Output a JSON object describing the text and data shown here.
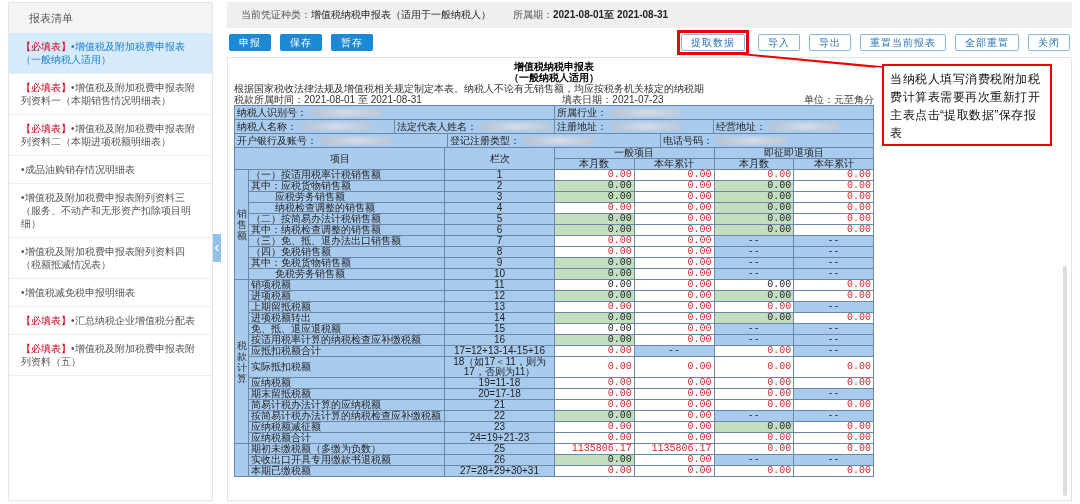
{
  "sidebar": {
    "title": "报表清单",
    "items": [
      {
        "tag": "【必填表】",
        "text": "•增值税及附加税费申报表（一般纳税人适用）",
        "selected": true
      },
      {
        "tag": "【必填表】",
        "text": "•增值税及附加税费申报表附列资料一（本期销售情况明细表）",
        "selected": false
      },
      {
        "tag": "【必填表】",
        "text": "•增值税及附加税费申报表附列资料二（本期进项税额明细表）",
        "selected": false
      },
      {
        "text": "•成品油购销存情况明细表",
        "selected": false
      },
      {
        "text": "•增值税及附加税费申报表附列资料三（服务、不动产和无形资产扣除项目明细）",
        "selected": false
      },
      {
        "text": "•增值税及附加税费申报表附列资料四（税额抵减情况表）",
        "selected": false
      },
      {
        "text": "•增值税减免税申报明细表",
        "selected": false
      },
      {
        "tag": "【必填表】",
        "text": "•汇总纳税企业增值税分配表",
        "selected": false
      },
      {
        "tag": "【必填表】",
        "text": "•增值税及附加税费申报表附列资料（五）",
        "selected": false
      }
    ]
  },
  "info_bar": [
    {
      "label": "当前凭证种类：",
      "value": "增值税纳税申报表（适用于一般纳税人）"
    },
    {
      "label": "所属期：",
      "value": "2021-08-01至 2021-08-31"
    }
  ],
  "actions_left": [
    "申报",
    "保存",
    "暂存"
  ],
  "actions_right": [
    {
      "label": "提取数据",
      "highlighted": true
    },
    {
      "label": "导入",
      "highlighted": false
    },
    {
      "label": "导出",
      "highlighted": false
    },
    {
      "label": "重置当前报表",
      "highlighted": false
    },
    {
      "label": "全部重置",
      "highlighted": false
    },
    {
      "label": "关闭",
      "highlighted": false
    }
  ],
  "form": {
    "title": "增值税纳税申报表",
    "subtitle": "（一般纳税人适用）",
    "notice": "根据国家税收法律法规及增值税相关规定制定本表。纳税人不论有无销售额，均应按税务机关核定的纳税期",
    "period": "税款所属时间：2021-08-01 至 2021-08-31",
    "fill_date": "填表日期：2021-07-23",
    "unit": "单位：元至角分",
    "info_rows": [
      [
        {
          "label": "纳税人识别号："
        },
        {
          "label": "所属行业："
        }
      ],
      [
        {
          "label": "纳税人名称："
        },
        {
          "label": "法定代表人姓名："
        },
        {
          "label": "注册地址："
        },
        {
          "label": "经营地址："
        }
      ],
      [
        {
          "label": "开户银行及账号："
        },
        {
          "label": "登记注册类型："
        },
        {
          "label": "电话号码："
        }
      ]
    ],
    "table": {
      "item_header": "项目",
      "line_header": "栏次",
      "column_groups": [
        {
          "label": "一般项目",
          "columns": [
            "本月数",
            "本年累计"
          ]
        },
        {
          "label": "即征即退项目",
          "columns": [
            "本月数",
            "本年累计"
          ]
        }
      ],
      "groups": [
        {
          "label": "销售额",
          "rows": [
            {
              "item": "（一）按适用税率计税销售额",
              "indent": false,
              "line": "1",
              "cells": [
                {
                  "text": "0.00",
                  "kind": "calc"
                },
                {
                  "text": "0.00",
                  "kind": "calc"
                },
                {
                  "text": "0.00",
                  "kind": "calc"
                },
                {
                  "text": "0.00",
                  "kind": "calc"
                }
              ]
            },
            {
              "item": "其中：应税货物销售额",
              "indent": false,
              "line": "2",
              "cells": [
                {
                  "text": "0.00",
                  "kind": "entry"
                },
                {
                  "text": "0.00",
                  "kind": "calc"
                },
                {
                  "text": "0.00",
                  "kind": "entry"
                },
                {
                  "text": "0.00",
                  "kind": "calc"
                }
              ]
            },
            {
              "item": "应税劳务销售额",
              "indent": true,
              "line": "3",
              "cells": [
                {
                  "text": "0.00",
                  "kind": "entry"
                },
                {
                  "text": "0.00",
                  "kind": "calc"
                },
                {
                  "text": "0.00",
                  "kind": "entry"
                },
                {
                  "text": "0.00",
                  "kind": "calc"
                }
              ]
            },
            {
              "item": "纳税检查调整的销售额",
              "indent": true,
              "line": "4",
              "cells": [
                {
                  "text": "0.00",
                  "kind": "calc"
                },
                {
                  "text": "0.00",
                  "kind": "calc"
                },
                {
                  "text": "0.00",
                  "kind": "entry"
                },
                {
                  "text": "0.00",
                  "kind": "calc"
                }
              ]
            },
            {
              "item": "（二）按简易办法计税销售额",
              "indent": false,
              "line": "5",
              "cells": [
                {
                  "text": "0.00",
                  "kind": "entry"
                },
                {
                  "text": "0.00",
                  "kind": "calc"
                },
                {
                  "text": "0.00",
                  "kind": "entry"
                },
                {
                  "text": "0.00",
                  "kind": "calc"
                }
              ]
            },
            {
              "item": "其中：纳税检查调整的销售额",
              "indent": false,
              "line": "6",
              "cells": [
                {
                  "text": "0.00",
                  "kind": "entry"
                },
                {
                  "text": "0.00",
                  "kind": "calc"
                },
                {
                  "text": "0.00",
                  "kind": "entry"
                },
                {
                  "text": "0.00",
                  "kind": "calc"
                }
              ]
            },
            {
              "item": "（三）免、抵、退办法出口销售额",
              "indent": false,
              "line": "7",
              "cells": [
                {
                  "text": "0.00",
                  "kind": "calc"
                },
                {
                  "text": "0.00",
                  "kind": "calc"
                },
                {
                  "text": "--",
                  "kind": "locked"
                },
                {
                  "text": "--",
                  "kind": "locked"
                }
              ]
            },
            {
              "item": "（四）免税销售额",
              "indent": false,
              "line": "8",
              "cells": [
                {
                  "text": "0.00",
                  "kind": "calc"
                },
                {
                  "text": "0.00",
                  "kind": "calc"
                },
                {
                  "text": "--",
                  "kind": "locked"
                },
                {
                  "text": "--",
                  "kind": "locked"
                }
              ]
            },
            {
              "item": "其中：免税货物销售额",
              "indent": false,
              "line": "9",
              "cells": [
                {
                  "text": "0.00",
                  "kind": "entry"
                },
                {
                  "text": "0.00",
                  "kind": "calc"
                },
                {
                  "text": "--",
                  "kind": "locked"
                },
                {
                  "text": "--",
                  "kind": "locked"
                }
              ]
            },
            {
              "item": "免税劳务销售额",
              "indent": true,
              "line": "10",
              "cells": [
                {
                  "text": "0.00",
                  "kind": "entry"
                },
                {
                  "text": "0.00",
                  "kind": "calc"
                },
                {
                  "text": "--",
                  "kind": "locked"
                },
                {
                  "text": "--",
                  "kind": "locked"
                }
              ]
            }
          ]
        },
        {
          "label": "税款计算",
          "rows": [
            {
              "item": "销项税额",
              "indent": false,
              "line": "11",
              "cells": [
                {
                  "text": "0.00",
                  "kind": "plain"
                },
                {
                  "text": "0.00",
                  "kind": "calc"
                },
                {
                  "text": "0.00",
                  "kind": "plain"
                },
                {
                  "text": "0.00",
                  "kind": "calc"
                }
              ]
            },
            {
              "item": "进项税额",
              "indent": false,
              "line": "12",
              "cells": [
                {
                  "text": "0.00",
                  "kind": "entry"
                },
                {
                  "text": "0.00",
                  "kind": "calc"
                },
                {
                  "text": "0.00",
                  "kind": "entry"
                },
                {
                  "text": "0.00",
                  "kind": "calc"
                }
              ]
            },
            {
              "item": "上期留抵税额",
              "indent": false,
              "line": "13",
              "cells": [
                {
                  "text": "0.00",
                  "kind": "calc"
                },
                {
                  "text": "0.00",
                  "kind": "calc"
                },
                {
                  "text": "0.00",
                  "kind": "calc"
                },
                {
                  "text": "--",
                  "kind": "locked"
                }
              ]
            },
            {
              "item": "进项税额转出",
              "indent": false,
              "line": "14",
              "cells": [
                {
                  "text": "0.00",
                  "kind": "entry"
                },
                {
                  "text": "0.00",
                  "kind": "calc"
                },
                {
                  "text": "0.00",
                  "kind": "entry"
                },
                {
                  "text": "0.00",
                  "kind": "calc"
                }
              ]
            },
            {
              "item": "免、抵、退应退税额",
              "indent": false,
              "line": "15",
              "cells": [
                {
                  "text": "0.00",
                  "kind": "plain"
                },
                {
                  "text": "0.00",
                  "kind": "calc"
                },
                {
                  "text": "--",
                  "kind": "locked"
                },
                {
                  "text": "--",
                  "kind": "locked"
                }
              ]
            },
            {
              "item": "按适用税率计算的纳税检查应补缴税额",
              "indent": false,
              "line": "16",
              "cells": [
                {
                  "text": "0.00",
                  "kind": "entry"
                },
                {
                  "text": "0.00",
                  "kind": "calc"
                },
                {
                  "text": "--",
                  "kind": "locked"
                },
                {
                  "text": "--",
                  "kind": "locked"
                }
              ]
            },
            {
              "item": "应抵扣税额合计",
              "indent": false,
              "line": "17=12+13-14-15+16",
              "cells": [
                {
                  "text": "0.00",
                  "kind": "calc"
                },
                {
                  "text": "--",
                  "kind": "locked"
                },
                {
                  "text": "0.00",
                  "kind": "calc"
                },
                {
                  "text": "--",
                  "kind": "locked"
                }
              ]
            },
            {
              "item": "实际抵扣税额",
              "indent": false,
              "line": "18（如17＜11，则为17，否则为11）",
              "cells": [
                {
                  "text": "0.00",
                  "kind": "calc"
                },
                {
                  "text": "0.00",
                  "kind": "calc"
                },
                {
                  "text": "0.00",
                  "kind": "calc"
                },
                {
                  "text": "0.00",
                  "kind": "calc"
                }
              ]
            },
            {
              "item": "应纳税额",
              "indent": false,
              "line": "19=11-18",
              "cells": [
                {
                  "text": "0.00",
                  "kind": "calc"
                },
                {
                  "text": "0.00",
                  "kind": "calc"
                },
                {
                  "text": "0.00",
                  "kind": "calc"
                },
                {
                  "text": "0.00",
                  "kind": "calc"
                }
              ]
            },
            {
              "item": "期末留抵税额",
              "indent": false,
              "line": "20=17-18",
              "cells": [
                {
                  "text": "0.00",
                  "kind": "calc"
                },
                {
                  "text": "0.00",
                  "kind": "calc"
                },
                {
                  "text": "0.00",
                  "kind": "calc"
                },
                {
                  "text": "--",
                  "kind": "locked"
                }
              ]
            },
            {
              "item": "简易计税办法计算的应纳税额",
              "indent": false,
              "line": "21",
              "cells": [
                {
                  "text": "0.00",
                  "kind": "calc"
                },
                {
                  "text": "0.00",
                  "kind": "calc"
                },
                {
                  "text": "0.00",
                  "kind": "calc"
                },
                {
                  "text": "0.00",
                  "kind": "calc"
                }
              ]
            },
            {
              "item": "按简易计税办法计算的纳税检查应补缴税额",
              "indent": false,
              "line": "22",
              "cells": [
                {
                  "text": "0.00",
                  "kind": "entry"
                },
                {
                  "text": "0.00",
                  "kind": "calc"
                },
                {
                  "text": "--",
                  "kind": "locked"
                },
                {
                  "text": "--",
                  "kind": "locked"
                }
              ]
            },
            {
              "item": "应纳税额减征额",
              "indent": false,
              "line": "23",
              "cells": [
                {
                  "text": "0.00",
                  "kind": "calc"
                },
                {
                  "text": "0.00",
                  "kind": "calc"
                },
                {
                  "text": "0.00",
                  "kind": "entry"
                },
                {
                  "text": "0.00",
                  "kind": "calc"
                }
              ]
            },
            {
              "item": "应纳税额合计",
              "indent": false,
              "line": "24=19+21-23",
              "cells": [
                {
                  "text": "0.00",
                  "kind": "calc"
                },
                {
                  "text": "0.00",
                  "kind": "calc"
                },
                {
                  "text": "0.00",
                  "kind": "calc"
                },
                {
                  "text": "0.00",
                  "kind": "calc"
                }
              ]
            }
          ]
        },
        {
          "rows": [
            {
              "item": "期初未缴税额（多缴为负数）",
              "indent": false,
              "line": "25",
              "cells": [
                {
                  "text": "1135806.17",
                  "kind": "calc"
                },
                {
                  "text": "1135806.17",
                  "kind": "calc"
                },
                {
                  "text": "0.00",
                  "kind": "calc"
                },
                {
                  "text": "0.00",
                  "kind": "calc"
                }
              ]
            },
            {
              "item": "实收出口开具专用缴款书退税额",
              "indent": false,
              "line": "26",
              "cells": [
                {
                  "text": "0.00",
                  "kind": "entry"
                },
                {
                  "text": "0.00",
                  "kind": "calc"
                },
                {
                  "text": "--",
                  "kind": "locked"
                },
                {
                  "text": "--",
                  "kind": "locked"
                }
              ]
            },
            {
              "item": "本期已缴税额",
              "indent": false,
              "line": "27=28+29+30+31",
              "cells": [
                {
                  "text": "0.00",
                  "kind": "calc"
                },
                {
                  "text": "0.00",
                  "kind": "calc"
                },
                {
                  "text": "0.00",
                  "kind": "calc"
                },
                {
                  "text": "0.00",
                  "kind": "calc"
                }
              ]
            }
          ]
        }
      ]
    }
  },
  "callout": {
    "text": "当纳税人填写消费税附加税费计算表需要再次重新打开主表点击“提取数据”保存报表"
  }
}
